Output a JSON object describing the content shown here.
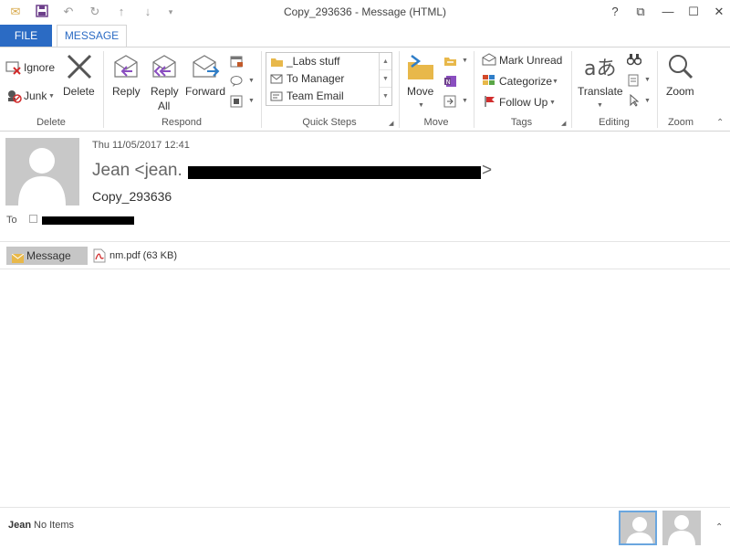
{
  "window": {
    "title": "Copy_293636 - Message (HTML)",
    "help_glyph": "?",
    "restore_ribbon_glyph": "⧉",
    "minimize_glyph": "—",
    "maximize_glyph": "☐",
    "close_glyph": "✕"
  },
  "tabs": {
    "file": "FILE",
    "message": "MESSAGE"
  },
  "ribbon": {
    "delete_group": {
      "label": "Delete",
      "ignore": "Ignore",
      "junk": "Junk",
      "delete": "Delete"
    },
    "respond_group": {
      "label": "Respond",
      "reply": "Reply",
      "reply_all_1": "Reply",
      "reply_all_2": "All",
      "forward": "Forward"
    },
    "quick_steps": {
      "label": "Quick Steps",
      "items": [
        "_Labs stuff",
        "To Manager",
        "Team Email"
      ]
    },
    "move_group": {
      "label": "Move",
      "move": "Move"
    },
    "tags_group": {
      "label": "Tags",
      "mark_unread": "Mark Unread",
      "categorize": "Categorize",
      "follow_up": "Follow Up"
    },
    "editing_group": {
      "label": "Editing",
      "translate": "Translate"
    },
    "zoom_group": {
      "label": "Zoom",
      "zoom": "Zoom"
    }
  },
  "message": {
    "date": "Thu 11/05/2017 12:41",
    "sender_prefix": "Jean <jean.",
    "sender_suffix": ">",
    "subject": "Copy_293636",
    "to_label": "To"
  },
  "attachments": {
    "message_tab": "Message",
    "file": "nm.pdf (63 KB)"
  },
  "people_pane": {
    "name": "Jean",
    "status": "No Items"
  },
  "colors": {
    "accent": "#2b6bc4",
    "background": "#ffffff"
  }
}
